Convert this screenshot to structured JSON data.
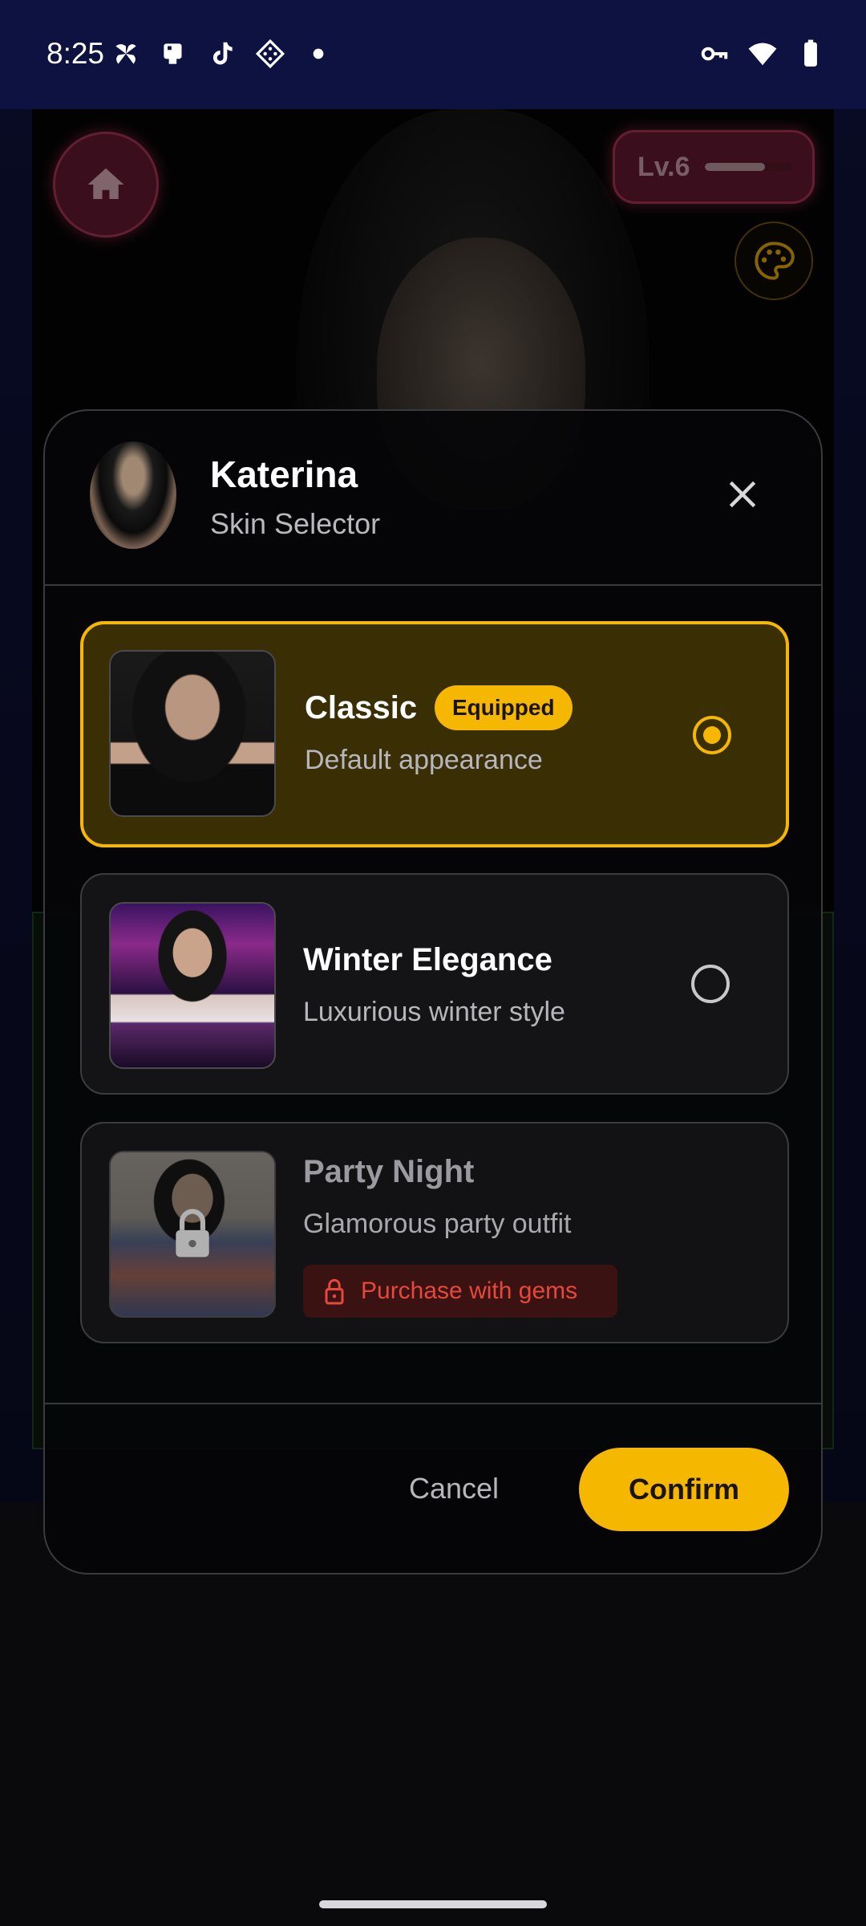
{
  "status_bar": {
    "time": "8:25",
    "left_icons": [
      "pinwheel-app-icon",
      "notification-app-icon",
      "tiktok-icon",
      "game-app-icon",
      "dot-icon"
    ],
    "right_icons": [
      "vpn-key-icon",
      "wifi-icon",
      "battery-icon"
    ]
  },
  "app": {
    "level_label": "Lv.6",
    "level_progress": 0.7
  },
  "dialog": {
    "character_name": "Katerina",
    "subtitle": "Skin Selector",
    "skins": [
      {
        "name": "Classic",
        "description": "Default appearance",
        "badge": "Equipped",
        "selected": true,
        "locked": false
      },
      {
        "name": "Winter Elegance",
        "description": "Luxurious winter style",
        "selected": false,
        "locked": false
      },
      {
        "name": "Party Night",
        "description": "Glamorous party outfit",
        "purchase_label": "Purchase with gems",
        "selected": false,
        "locked": true
      }
    ],
    "cancel_label": "Cancel",
    "confirm_label": "Confirm"
  },
  "colors": {
    "accent": "#f5b700",
    "selected_card_bg": "#3a2e05",
    "lock_red": "#e5483c",
    "home_button": "#6b1a33",
    "status_bar_bg": "#0e1240"
  }
}
